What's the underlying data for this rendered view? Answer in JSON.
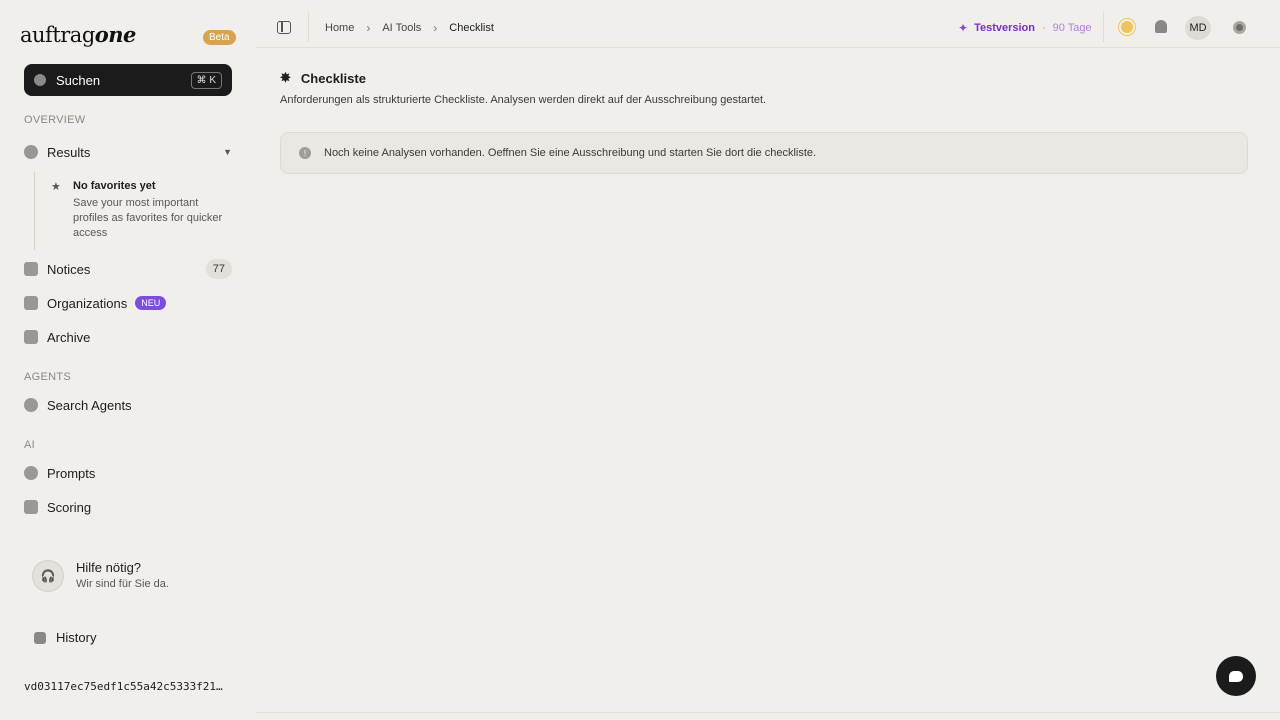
{
  "brand": {
    "name_a": "auftrag",
    "name_b": "one",
    "badge": "Beta"
  },
  "search": {
    "label": "Suchen",
    "shortcut": "⌘ K"
  },
  "sections": {
    "overview": "OVERVIEW",
    "agents": "AGENTS",
    "ai": "AI"
  },
  "nav": {
    "results": "Results",
    "notices": "Notices",
    "notices_count": "77",
    "organizations": "Organizations",
    "organizations_badge": "NEU",
    "archive": "Archive",
    "search_agents": "Search Agents",
    "prompts": "Prompts",
    "scoring": "Scoring"
  },
  "favorites": {
    "title": "No favorites yet",
    "description": "Save your most important profiles as favorites for quicker access"
  },
  "help": {
    "title": "Hilfe nötig?",
    "subtitle": "Wir sind für Sie da."
  },
  "history": "History",
  "version_hash": "vd03117ec75edf1c55a42c5333f21…",
  "breadcrumb": {
    "home": "Home",
    "tools": "AI Tools",
    "current": "Checklist"
  },
  "trial": {
    "label": "Testversion",
    "days": "90 Tage"
  },
  "user": {
    "initials": "MD"
  },
  "page": {
    "title": "Checkliste",
    "subtitle": "Anforderungen als strukturierte Checkliste. Analysen werden direkt auf der Ausschreibung gestartet.",
    "notice": "Noch keine Analysen vorhanden. Oeffnen Sie eine Ausschreibung und starten Sie dort die checkliste."
  },
  "colors": {
    "accent": "#7c4ddf",
    "beta": "#d9a24c",
    "trial": "#7a2ec4"
  }
}
